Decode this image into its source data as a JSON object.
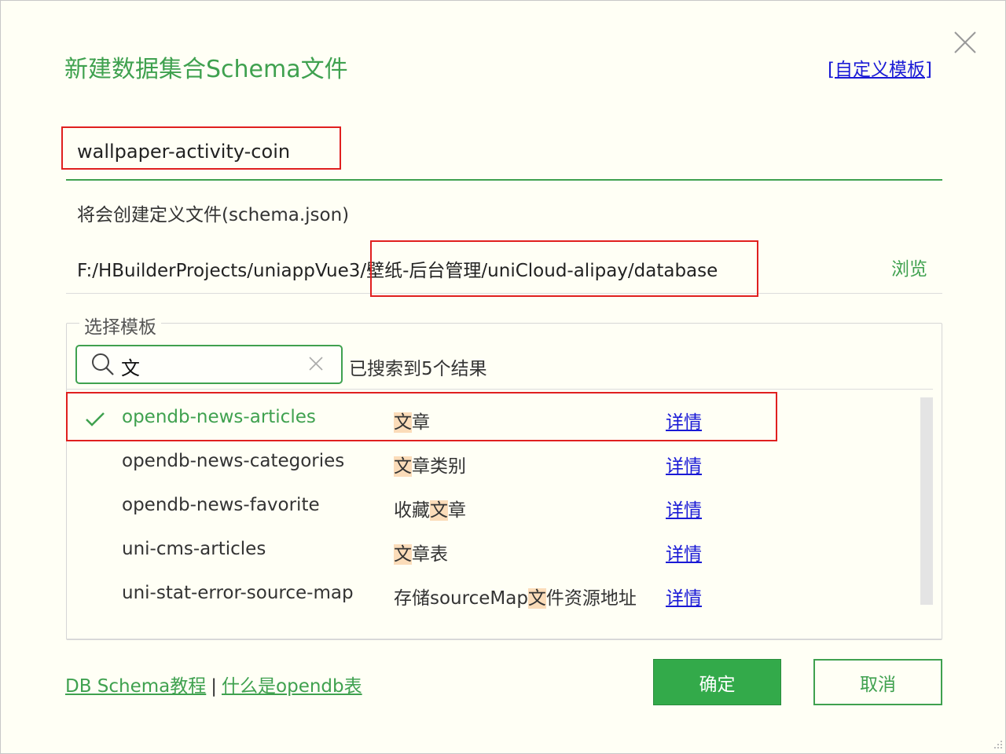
{
  "dialog": {
    "title": "新建数据集合Schema文件",
    "custom_template_link": "[自定义模板]",
    "name_value": "wallpaper-activity-coin",
    "hint": "将会创建定义文件(schema.json)",
    "path": "F:/HBuilderProjects/uniappVue3/壁纸-后台管理/uniCloud-alipay/database",
    "browse_label": "浏览"
  },
  "template": {
    "legend": "选择模板",
    "search_value": "文",
    "result_count": "已搜索到5个结果",
    "detail_label": "详情",
    "rows": [
      {
        "name": "opendb-news-articles",
        "desc_pre": "",
        "desc_hl": "文",
        "desc_post": "章",
        "selected": true
      },
      {
        "name": "opendb-news-categories",
        "desc_pre": "",
        "desc_hl": "文",
        "desc_post": "章类别",
        "selected": false
      },
      {
        "name": "opendb-news-favorite",
        "desc_pre": "收藏",
        "desc_hl": "文",
        "desc_post": "章",
        "selected": false
      },
      {
        "name": "uni-cms-articles",
        "desc_pre": "",
        "desc_hl": "文",
        "desc_post": "章表",
        "selected": false
      },
      {
        "name": "uni-stat-error-source-map",
        "desc_pre": "存储sourceMap",
        "desc_hl": "文",
        "desc_post": "件资源地址",
        "selected": false
      }
    ]
  },
  "footer": {
    "link_tutorial": "DB Schema教程",
    "separator": "|",
    "link_opendb": "什么是opendb表",
    "ok_label": "确定",
    "cancel_label": "取消"
  },
  "colors": {
    "accent": "#3fa14f",
    "link": "#1a1ad6",
    "highlight": "#fbdcb9",
    "annotation_red": "#e0201f",
    "background": "#fffff5"
  },
  "icons": [
    "close-icon",
    "search-icon",
    "clear-icon",
    "check-icon",
    "resize-grip-icon"
  ]
}
